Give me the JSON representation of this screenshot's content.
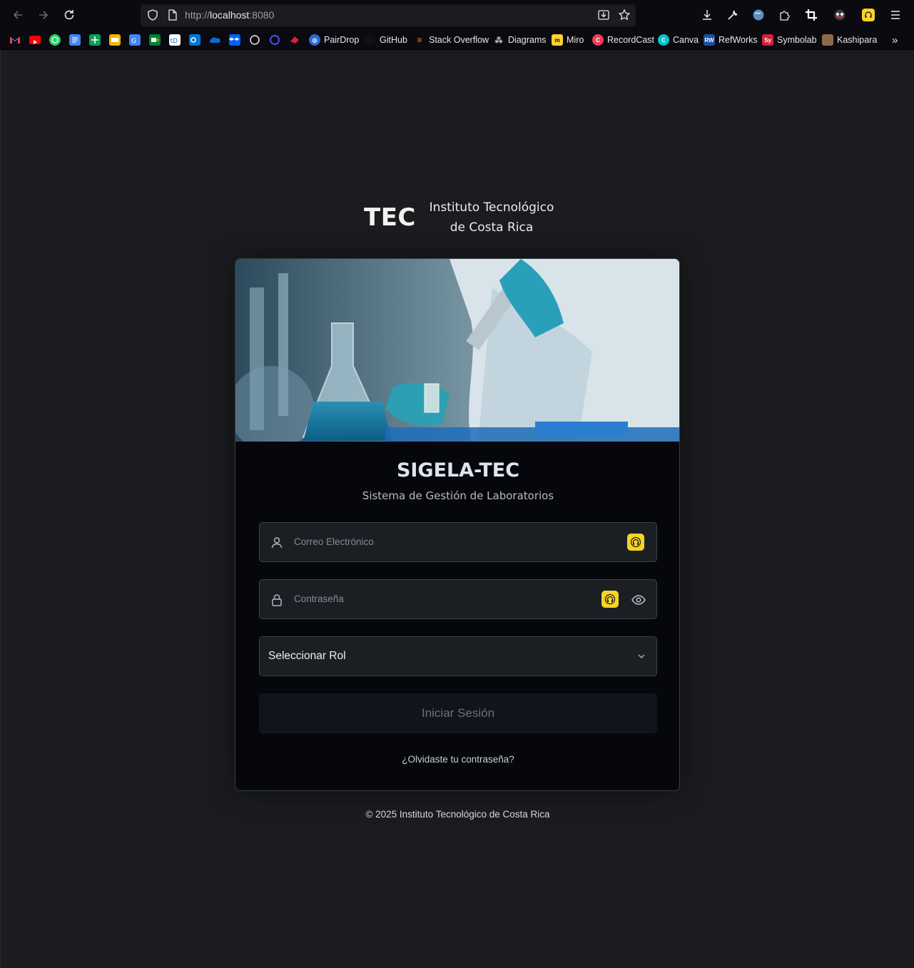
{
  "browser": {
    "url_prefix": "http://",
    "url_host": "localhost",
    "url_port": ":8080",
    "bookmarks": [
      "PairDrop",
      "GitHub",
      "Stack Overflow",
      "Diagrams",
      "Miro",
      "RecordCast",
      "Canva",
      "RefWorks",
      "Symbolab",
      "Kashipara"
    ],
    "bookmark_badges": {
      "refworks": "RW",
      "symbolab": "Sy",
      "tdrive": "tD"
    }
  },
  "header": {
    "logo": "TEC",
    "institute_line1": "Instituto Tecnológico",
    "institute_line2": "de Costa Rica"
  },
  "login": {
    "title": "SIGELA-TEC",
    "subtitle": "Sistema de Gestión de Laboratorios",
    "email_placeholder": "Correo Electrónico",
    "password_placeholder": "Contraseña",
    "role_select": "Seleccionar Rol",
    "submit_label": "Iniciar Sesión",
    "forgot_link": "¿Olvidaste tu contraseña?"
  },
  "footer": {
    "copyright": "© 2025 Instituto Tecnológico de Costa Rica"
  },
  "colors": {
    "page_bg": "#1b1c1f",
    "card_bg": "#05070c",
    "field_bg": "#1b1f24",
    "extension_badge": "#f5d423"
  }
}
